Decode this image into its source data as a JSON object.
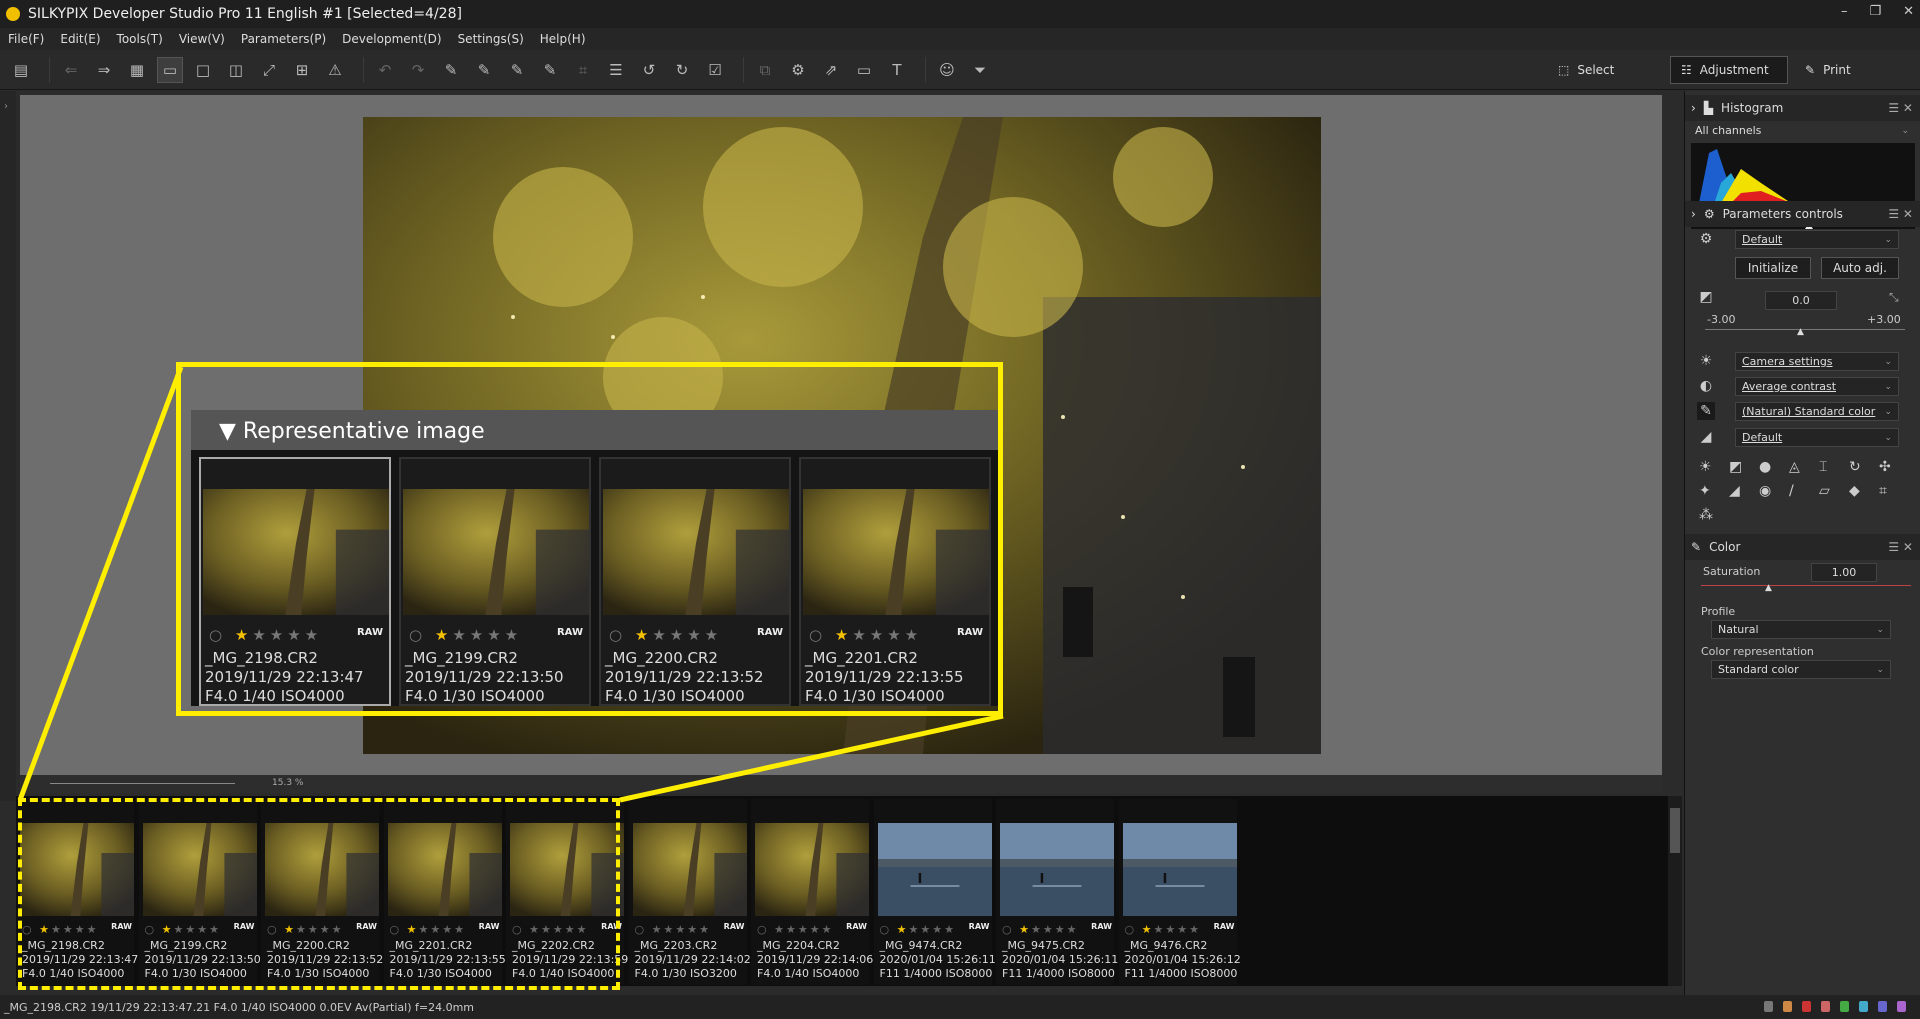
{
  "window": {
    "title": "SILKYPIX Developer Studio Pro 11 English   #1   [Selected=4/28]",
    "controls": [
      "–",
      "❐",
      "✕"
    ]
  },
  "menu": [
    "File(F)",
    "Edit(E)",
    "Tools(T)",
    "View(V)",
    "Parameters(P)",
    "Development(D)",
    "Settings(S)",
    "Help(H)"
  ],
  "modes": {
    "select": "Select",
    "adjustment": "Adjustment",
    "print": "Print"
  },
  "zoom": {
    "value": "15.3",
    "unit": "%"
  },
  "callout": {
    "title": "▼ Representative image"
  },
  "representative": [
    {
      "name": "_MG_2198.CR2",
      "date": "2019/11/29 22:13:47",
      "exif": "F4.0 1/40 ISO4000",
      "stars": 1,
      "raw": "RAW",
      "selected": true
    },
    {
      "name": "_MG_2199.CR2",
      "date": "2019/11/29 22:13:50",
      "exif": "F4.0 1/30 ISO4000",
      "stars": 1,
      "raw": "RAW",
      "selected": false
    },
    {
      "name": "_MG_2200.CR2",
      "date": "2019/11/29 22:13:52",
      "exif": "F4.0 1/30 ISO4000",
      "stars": 1,
      "raw": "RAW",
      "selected": false
    },
    {
      "name": "_MG_2201.CR2",
      "date": "2019/11/29 22:13:55",
      "exif": "F4.0 1/30 ISO4000",
      "stars": 1,
      "raw": "RAW",
      "selected": false
    }
  ],
  "filmstrip": [
    {
      "name": "_MG_2198.CR2",
      "date": "2019/11/29 22:13:47",
      "exif": "F4.0 1/40 ISO4000",
      "stars": 1,
      "raw": "RAW",
      "kind": "tree"
    },
    {
      "name": "_MG_2199.CR2",
      "date": "2019/11/29 22:13:50",
      "exif": "F4.0 1/30 ISO4000",
      "stars": 1,
      "raw": "RAW",
      "kind": "tree"
    },
    {
      "name": "_MG_2200.CR2",
      "date": "2019/11/29 22:13:52",
      "exif": "F4.0 1/30 ISO4000",
      "stars": 1,
      "raw": "RAW",
      "kind": "tree"
    },
    {
      "name": "_MG_2201.CR2",
      "date": "2019/11/29 22:13:55",
      "exif": "F4.0 1/30 ISO4000",
      "stars": 1,
      "raw": "RAW",
      "kind": "tree"
    },
    {
      "name": "_MG_2202.CR2",
      "date": "2019/11/29 22:13:59",
      "exif": "F4.0 1/40 ISO4000",
      "stars": 0,
      "raw": "RAW",
      "kind": "tree"
    },
    {
      "name": "_MG_2203.CR2",
      "date": "2019/11/29 22:14:02",
      "exif": "F4.0 1/30 ISO3200",
      "stars": 0,
      "raw": "RAW",
      "kind": "tree"
    },
    {
      "name": "_MG_2204.CR2",
      "date": "2019/11/29 22:14:06",
      "exif": "F4.0 1/40 ISO4000",
      "stars": 0,
      "raw": "RAW",
      "kind": "tree"
    },
    {
      "name": "_MG_9474.CR2",
      "date": "2020/01/04 15:26:11",
      "exif": "F11 1/4000 ISO8000",
      "stars": 1,
      "raw": "RAW",
      "kind": "sea"
    },
    {
      "name": "_MG_9475.CR2",
      "date": "2020/01/04 15:26:11",
      "exif": "F11 1/4000 ISO8000",
      "stars": 1,
      "raw": "RAW",
      "kind": "sea"
    },
    {
      "name": "_MG_9476.CR2",
      "date": "2020/01/04 15:26:12",
      "exif": "F11 1/4000 ISO8000",
      "stars": 1,
      "raw": "RAW",
      "kind": "sea"
    }
  ],
  "status": {
    "text": "_MG_2198.CR2 19/11/29 22:13:47.21 F4.0 1/40 ISO4000  0.0EV Av(Partial) f=24.0mm"
  },
  "panel": {
    "histogram": {
      "title": "Histogram",
      "channel": "All channels"
    },
    "params": {
      "title": "Parameters controls",
      "preset": "Default",
      "initialize": "Initialize",
      "auto_adj": "Auto adj.",
      "exposure": "0.0",
      "exp_min": "-3.00",
      "exp_max": "+3.00",
      "white_balance": "Camera settings",
      "tone": "Average contrast",
      "color_style": "(Natural) Standard color",
      "sharpness": "Default"
    },
    "color": {
      "title": "Color",
      "saturation_label": "Saturation",
      "saturation": "1.00",
      "profile_label": "Profile",
      "profile": "Natural",
      "rep_label": "Color representation",
      "rep": "Standard color"
    }
  }
}
